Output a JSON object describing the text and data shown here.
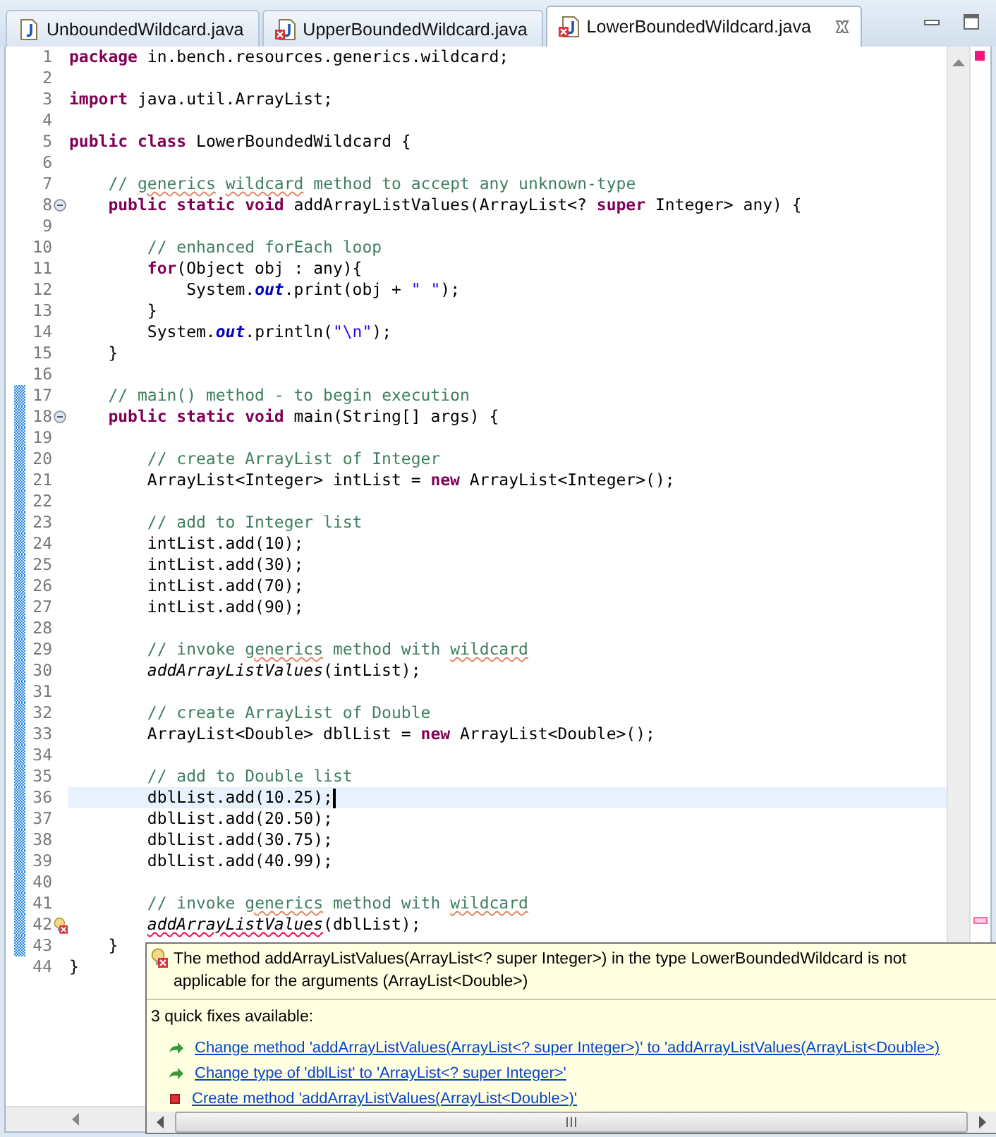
{
  "tabs": [
    {
      "label": "UnboundedWildcard.java",
      "selected": false,
      "error": false
    },
    {
      "label": "UpperBoundedWildcard.java",
      "selected": false,
      "error": true
    },
    {
      "label": "LowerBoundedWildcard.java",
      "selected": true,
      "error": true
    }
  ],
  "editor": {
    "lines": [
      {
        "number": "1",
        "changed": false,
        "current": false,
        "collapsible": false,
        "error": false,
        "tokens": [
          {
            "kind": "keyword",
            "text": "package"
          },
          {
            "kind": "text",
            "text": " in.bench.resources.generics.wildcard;"
          }
        ]
      },
      {
        "number": "2",
        "changed": false,
        "current": false,
        "collapsible": false,
        "error": false
      },
      {
        "number": "3",
        "changed": false,
        "current": false,
        "collapsible": false,
        "error": false,
        "tokens": [
          {
            "kind": "keyword",
            "text": "import"
          },
          {
            "kind": "text",
            "text": " java.util.ArrayList;"
          }
        ]
      },
      {
        "number": "4",
        "changed": false,
        "current": false,
        "collapsible": false,
        "error": false
      },
      {
        "number": "5",
        "changed": false,
        "current": false,
        "collapsible": false,
        "error": false,
        "tokens": [
          {
            "kind": "keyword",
            "text": "public class"
          },
          {
            "kind": "text",
            "text": " LowerBoundedWildcard {"
          }
        ]
      },
      {
        "number": "6",
        "changed": false,
        "current": false,
        "collapsible": false,
        "error": false
      },
      {
        "number": "7",
        "changed": false,
        "current": false,
        "collapsible": false,
        "error": false,
        "tokens": [
          {
            "kind": "comment",
            "text": "    // "
          },
          {
            "kind": "spell",
            "text": "generics"
          },
          {
            "kind": "spell",
            "text": " wildcard"
          },
          {
            "kind": "comment",
            "text": " method to accept any unknown-type"
          }
        ]
      },
      {
        "number": "8",
        "changed": false,
        "current": false,
        "collapsible": true,
        "error": false,
        "tokens": [
          {
            "kind": "keyword",
            "text": "    public static void"
          },
          {
            "kind": "text",
            "text": " addArrayListValues(ArrayList<? "
          },
          {
            "kind": "keyword",
            "text": "super"
          },
          {
            "kind": "text",
            "text": " Integer> any) {"
          }
        ]
      },
      {
        "number": "9",
        "changed": false,
        "current": false,
        "collapsible": false,
        "error": false
      },
      {
        "number": "10",
        "changed": false,
        "current": false,
        "collapsible": false,
        "error": false,
        "tokens": [
          {
            "kind": "comment",
            "text": "        // enhanced forEach loop"
          }
        ]
      },
      {
        "number": "11",
        "changed": false,
        "current": false,
        "collapsible": false,
        "error": false,
        "tokens": [
          {
            "kind": "keyword",
            "text": "        for"
          },
          {
            "kind": "text",
            "text": "(Object obj : any){"
          }
        ]
      },
      {
        "number": "12",
        "changed": false,
        "current": false,
        "collapsible": false,
        "error": false,
        "tokens": [
          {
            "kind": "text",
            "text": "            System."
          },
          {
            "kind": "field",
            "text": "out"
          },
          {
            "kind": "text",
            "text": ".print(obj + "
          },
          {
            "kind": "string",
            "text": "\" \""
          },
          {
            "kind": "text",
            "text": ");"
          }
        ]
      },
      {
        "number": "13",
        "changed": false,
        "current": false,
        "collapsible": false,
        "error": false,
        "tokens": [
          {
            "kind": "text",
            "text": "        }"
          }
        ]
      },
      {
        "number": "14",
        "changed": false,
        "current": false,
        "collapsible": false,
        "error": false,
        "tokens": [
          {
            "kind": "text",
            "text": "        System."
          },
          {
            "kind": "field",
            "text": "out"
          },
          {
            "kind": "text",
            "text": ".println("
          },
          {
            "kind": "string",
            "text": "\"\\n\""
          },
          {
            "kind": "text",
            "text": ");"
          }
        ]
      },
      {
        "number": "15",
        "changed": false,
        "current": false,
        "collapsible": false,
        "error": false,
        "tokens": [
          {
            "kind": "text",
            "text": "    }"
          }
        ]
      },
      {
        "number": "16",
        "changed": false,
        "current": false,
        "collapsible": false,
        "error": false
      },
      {
        "number": "17",
        "changed": true,
        "current": false,
        "collapsible": false,
        "error": false,
        "tokens": [
          {
            "kind": "comment",
            "text": "    // main() method - to begin execution"
          }
        ]
      },
      {
        "number": "18",
        "changed": true,
        "current": false,
        "collapsible": true,
        "error": false,
        "tokens": [
          {
            "kind": "keyword",
            "text": "    public static void"
          },
          {
            "kind": "text",
            "text": " main(String[] args) {"
          }
        ]
      },
      {
        "number": "19",
        "changed": true,
        "current": false,
        "collapsible": false,
        "error": false
      },
      {
        "number": "20",
        "changed": true,
        "current": false,
        "collapsible": false,
        "error": false,
        "tokens": [
          {
            "kind": "comment",
            "text": "        // create ArrayList of Integer"
          }
        ]
      },
      {
        "number": "21",
        "changed": true,
        "current": false,
        "collapsible": false,
        "error": false,
        "tokens": [
          {
            "kind": "text",
            "text": "        ArrayList<Integer> intList = "
          },
          {
            "kind": "keyword",
            "text": "new"
          },
          {
            "kind": "text",
            "text": " ArrayList<Integer>();"
          }
        ]
      },
      {
        "number": "22",
        "changed": true,
        "current": false,
        "collapsible": false,
        "error": false
      },
      {
        "number": "23",
        "changed": true,
        "current": false,
        "collapsible": false,
        "error": false,
        "tokens": [
          {
            "kind": "comment",
            "text": "        // add to Integer list"
          }
        ]
      },
      {
        "number": "24",
        "changed": true,
        "current": false,
        "collapsible": false,
        "error": false,
        "tokens": [
          {
            "kind": "text",
            "text": "        intList.add(10);"
          }
        ]
      },
      {
        "number": "25",
        "changed": true,
        "current": false,
        "collapsible": false,
        "error": false,
        "tokens": [
          {
            "kind": "text",
            "text": "        intList.add(30);"
          }
        ]
      },
      {
        "number": "26",
        "changed": true,
        "current": false,
        "collapsible": false,
        "error": false,
        "tokens": [
          {
            "kind": "text",
            "text": "        intList.add(70);"
          }
        ]
      },
      {
        "number": "27",
        "changed": true,
        "current": false,
        "collapsible": false,
        "error": false,
        "tokens": [
          {
            "kind": "text",
            "text": "        intList.add(90);"
          }
        ]
      },
      {
        "number": "28",
        "changed": true,
        "current": false,
        "collapsible": false,
        "error": false
      },
      {
        "number": "29",
        "changed": true,
        "current": false,
        "collapsible": false,
        "error": false,
        "tokens": [
          {
            "kind": "comment",
            "text": "        // invoke "
          },
          {
            "kind": "spell",
            "text": "generics"
          },
          {
            "kind": "comment",
            "text": " method with "
          },
          {
            "kind": "spell",
            "text": "wildcard"
          }
        ]
      },
      {
        "number": "30",
        "changed": true,
        "current": false,
        "collapsible": false,
        "error": false,
        "tokens": [
          {
            "kind": "call",
            "text": "        addArrayListValues"
          },
          {
            "kind": "text",
            "text": "(intList);"
          }
        ]
      },
      {
        "number": "31",
        "changed": true,
        "current": false,
        "collapsible": false,
        "error": false
      },
      {
        "number": "32",
        "changed": true,
        "current": false,
        "collapsible": false,
        "error": false,
        "tokens": [
          {
            "kind": "comment",
            "text": "        // create ArrayList of Double"
          }
        ]
      },
      {
        "number": "33",
        "changed": true,
        "current": false,
        "collapsible": false,
        "error": false,
        "tokens": [
          {
            "kind": "text",
            "text": "        ArrayList<Double> dblList = "
          },
          {
            "kind": "keyword",
            "text": "new"
          },
          {
            "kind": "text",
            "text": " ArrayList<Double>();"
          }
        ]
      },
      {
        "number": "34",
        "changed": true,
        "current": false,
        "collapsible": false,
        "error": false
      },
      {
        "number": "35",
        "changed": true,
        "current": false,
        "collapsible": false,
        "error": false,
        "tokens": [
          {
            "kind": "comment",
            "text": "        // add to Double list"
          }
        ]
      },
      {
        "number": "36",
        "changed": true,
        "current": true,
        "collapsible": false,
        "error": false,
        "tokens": [
          {
            "kind": "text",
            "text": "        dblList.add(10.25);"
          }
        ]
      },
      {
        "number": "37",
        "changed": true,
        "current": false,
        "collapsible": false,
        "error": false,
        "tokens": [
          {
            "kind": "text",
            "text": "        dblList.add(20.50);"
          }
        ]
      },
      {
        "number": "38",
        "changed": true,
        "current": false,
        "collapsible": false,
        "error": false,
        "tokens": [
          {
            "kind": "text",
            "text": "        dblList.add(30.75);"
          }
        ]
      },
      {
        "number": "39",
        "changed": true,
        "current": false,
        "collapsible": false,
        "error": false,
        "tokens": [
          {
            "kind": "text",
            "text": "        dblList.add(40.99);"
          }
        ]
      },
      {
        "number": "40",
        "changed": true,
        "current": false,
        "collapsible": false,
        "error": false
      },
      {
        "number": "41",
        "changed": true,
        "current": false,
        "collapsible": false,
        "error": false,
        "tokens": [
          {
            "kind": "comment",
            "text": "        // invoke "
          },
          {
            "kind": "spell",
            "text": "generics"
          },
          {
            "kind": "comment",
            "text": " method with "
          },
          {
            "kind": "spell",
            "text": "wildcard"
          }
        ]
      },
      {
        "number": "42",
        "changed": true,
        "current": false,
        "collapsible": false,
        "error": true,
        "tokens": [
          {
            "kind": "call-error",
            "text": "        addArrayListValues"
          },
          {
            "kind": "text",
            "text": "(dblList);"
          }
        ]
      },
      {
        "number": "43",
        "changed": true,
        "current": false,
        "collapsible": false,
        "error": false,
        "tokens": [
          {
            "kind": "text",
            "text": "    }"
          }
        ]
      },
      {
        "number": "44",
        "changed": false,
        "current": false,
        "collapsible": false,
        "error": false,
        "tokens": [
          {
            "kind": "text",
            "text": "}"
          }
        ]
      }
    ]
  },
  "hover": {
    "message": "The method addArrayListValues(ArrayList<? super Integer>) in the type LowerBoundedWildcard is not applicable for the arguments (ArrayList<Double>)",
    "fixes_title": "3 quick fixes available:",
    "fixes": [
      {
        "kind": "change",
        "label": "Change method 'addArrayListValues(ArrayList<? super Integer>)' to 'addArrayListValues(ArrayList<Double>)"
      },
      {
        "kind": "change",
        "label": "Change type of 'dblList' to 'ArrayList<? super Integer>'"
      },
      {
        "kind": "create",
        "label": "Create method 'addArrayListValues(ArrayList<Double>)'"
      }
    ]
  }
}
